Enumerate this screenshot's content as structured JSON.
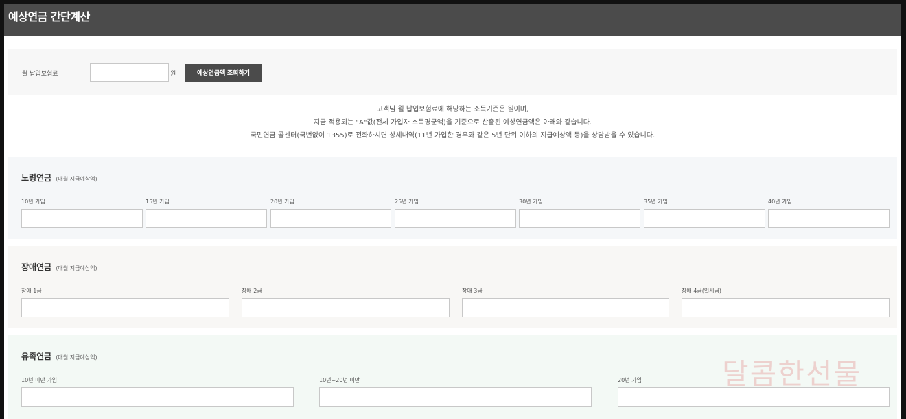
{
  "window": {
    "title": "예상연금 간단계산"
  },
  "payment": {
    "label": "월 납입보험료",
    "value": "",
    "unit": "원",
    "button_label": "예상연금액 조회하기"
  },
  "notice": {
    "line1": "고객님 월 납입보험료에 해당하는 소득기준은 원이며,",
    "line2": "지금 적용되는 \"A\"값(전체 가입자 소득평균액)을 기준으로 산출된 예상연금액은 아래와 같습니다.",
    "line3": "국민연금 콜센터(국번없이 1355)로 전화하시면 상세내역(11년 가입한 경우와 같은 5년 단위 이하의 지급예상액 등)을 상담받을 수 있습니다."
  },
  "old_age": {
    "title": "노령연금",
    "subtitle": "(매월 지급예상액)",
    "fields": [
      {
        "label": "10년 가입",
        "value": ""
      },
      {
        "label": "15년 가입",
        "value": ""
      },
      {
        "label": "20년 가입",
        "value": ""
      },
      {
        "label": "25년 가입",
        "value": ""
      },
      {
        "label": "30년 가입",
        "value": ""
      },
      {
        "label": "35년 가입",
        "value": ""
      },
      {
        "label": "40년 가입",
        "value": ""
      }
    ]
  },
  "disability": {
    "title": "장애연금",
    "subtitle": "(매월 지급예상액)",
    "fields": [
      {
        "label": "장애 1급",
        "value": ""
      },
      {
        "label": "장애 2급",
        "value": ""
      },
      {
        "label": "장애 3급",
        "value": ""
      },
      {
        "label": "장애 4급(일시금)",
        "value": ""
      }
    ]
  },
  "survivor": {
    "title": "유족연금",
    "subtitle": "(매월 지급예상액)",
    "fields": [
      {
        "label": "10년 미만 가입",
        "value": ""
      },
      {
        "label": "10년~20년 미만",
        "value": ""
      },
      {
        "label": "20년 가입",
        "value": ""
      }
    ]
  },
  "watermark": "달콤한선물"
}
